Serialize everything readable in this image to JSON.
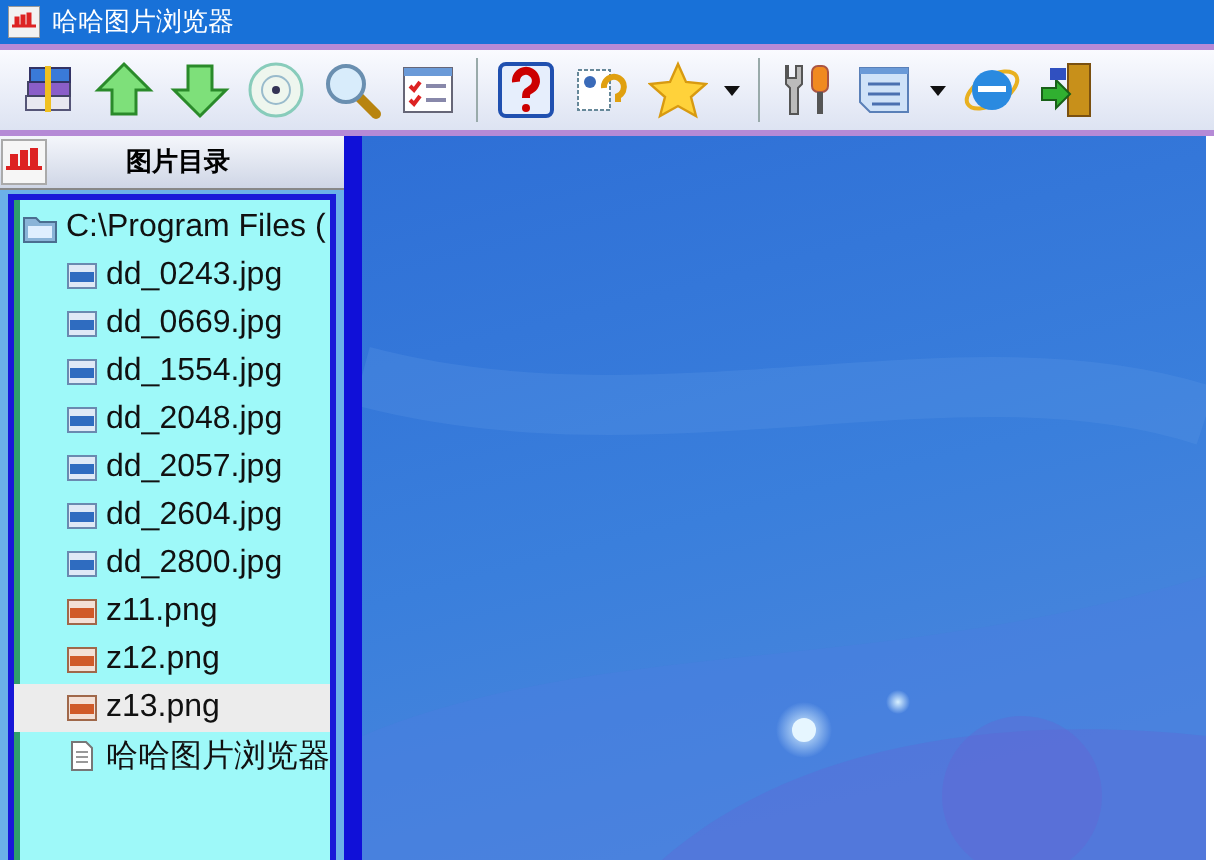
{
  "window": {
    "title": "哈哈图片浏览器"
  },
  "sidebar": {
    "title": "图片目录",
    "tree": [
      {
        "label": "C:\\Program Files (",
        "kind": "folder",
        "selected": false,
        "children": [
          {
            "label": "dd_0243.jpg",
            "kind": "jpg",
            "selected": false
          },
          {
            "label": "dd_0669.jpg",
            "kind": "jpg",
            "selected": false
          },
          {
            "label": "dd_1554.jpg",
            "kind": "jpg",
            "selected": false
          },
          {
            "label": "dd_2048.jpg",
            "kind": "jpg",
            "selected": false
          },
          {
            "label": "dd_2057.jpg",
            "kind": "jpg",
            "selected": false
          },
          {
            "label": "dd_2604.jpg",
            "kind": "jpg",
            "selected": false
          },
          {
            "label": "dd_2800.jpg",
            "kind": "jpg",
            "selected": false
          },
          {
            "label": "z11.png",
            "kind": "png",
            "selected": false
          },
          {
            "label": "z12.png",
            "kind": "png",
            "selected": false
          },
          {
            "label": "z13.png",
            "kind": "png",
            "selected": true
          },
          {
            "label": "哈哈图片浏览器",
            "kind": "file",
            "selected": false
          }
        ]
      }
    ]
  }
}
